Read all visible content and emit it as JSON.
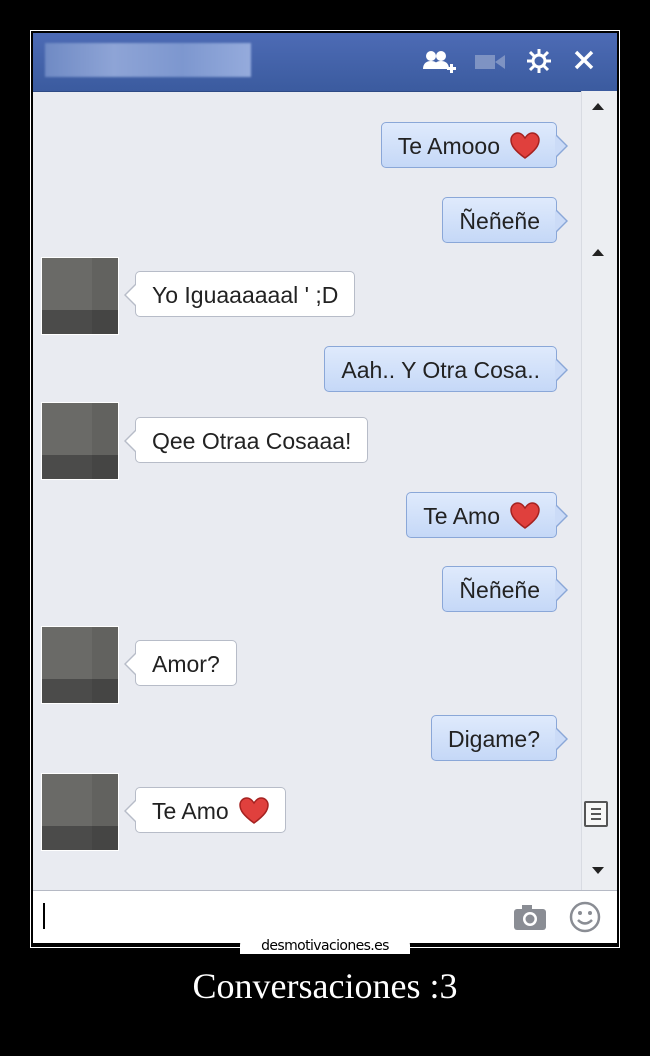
{
  "header": {
    "icons": [
      "add-friends-icon",
      "video-call-icon",
      "gear-icon",
      "close-icon"
    ]
  },
  "messages": [
    {
      "sender": "me",
      "text": "Te Amooo",
      "heart": true
    },
    {
      "sender": "me",
      "text": "Ñeñeñe",
      "heart": false
    },
    {
      "sender": "them",
      "text": "Yo Iguaaaaaal ' ;D",
      "heart": false
    },
    {
      "sender": "me",
      "text": "Aah.. Y Otra Cosa..",
      "heart": false
    },
    {
      "sender": "them",
      "text": "Qee Otraa Cosaaa!",
      "heart": false
    },
    {
      "sender": "me",
      "text": "Te Amo",
      "heart": true
    },
    {
      "sender": "me",
      "text": "Ñeñeñe",
      "heart": false
    },
    {
      "sender": "them",
      "text": "Amor?",
      "heart": false
    },
    {
      "sender": "me",
      "text": "Digame?",
      "heart": false
    },
    {
      "sender": "them",
      "text": "Te Amo",
      "heart": true
    }
  ],
  "input": {
    "value": "",
    "icons": [
      "camera-icon",
      "emoticon-icon"
    ]
  },
  "watermark": "desmotivaciones.es",
  "caption": "Conversaciones :3",
  "colors": {
    "header": "#3b5b9f",
    "my_bubble": "#c5d8f7",
    "their_bubble": "#ffffff",
    "heart": "#e0403d",
    "background": "#000000"
  }
}
